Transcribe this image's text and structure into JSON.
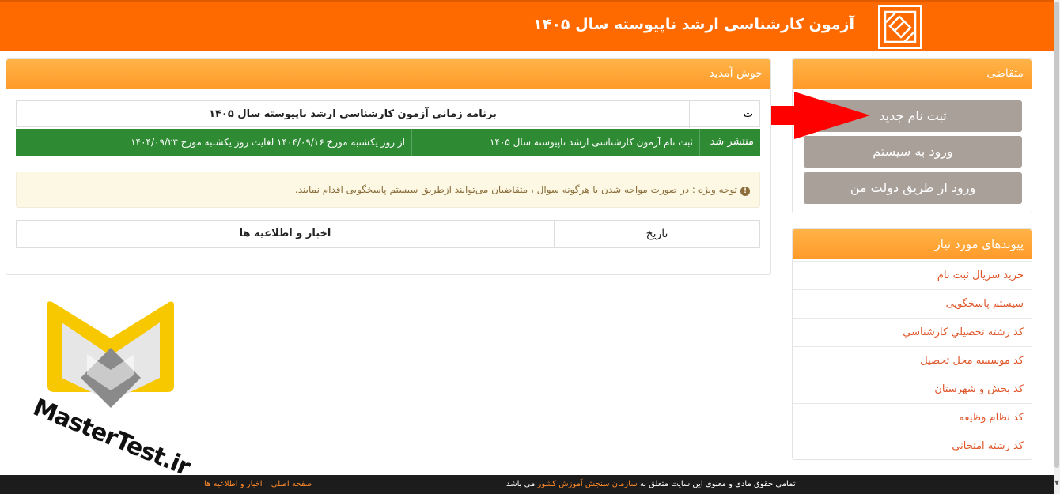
{
  "header": {
    "title": "آزمون کارشناسی ارشد ناپیوسته سال ۱۴۰۵"
  },
  "applicant_panel": {
    "title": "متقاضی",
    "buttons": {
      "register": "ثبت نام جدید",
      "login": "ورود به سیستم",
      "gov_login": "ورود از طریق دولت من"
    }
  },
  "links_panel": {
    "title": "پیوندهای مورد نیاز",
    "items": [
      "خرید سریال ثبت نام",
      "سیستم پاسخگویی",
      "کد رشته تحصيلي کارشناسي",
      "کد موسسه محل تحصيل",
      "کد بخش و شهرستان",
      "کد نظام وظيفه",
      "کد رشته امتحاني"
    ]
  },
  "welcome_panel": {
    "title": "خوش آمدید",
    "row1": {
      "label": "ت",
      "value": "برنامه زمانی آزمون کارشناسی ارشد ناپیوسته سال ۱۴۰۵"
    },
    "row2": {
      "status": "منتشر شد",
      "event": "ثبت نام آزمون کارشناسی ارشد ناپیوسته سال ۱۴۰۵",
      "date_range": "از روز یکشنبه مورخ ۱۴۰۴/۰۹/۱۶ لغایت روز یکشنبه مورخ ۱۴۰۴/۰۹/۲۳"
    },
    "notice": "توجه ویژه : در صورت مواجه شدن با هرگونه سوال ، متقاضیان می‌توانند ازطریق سیستم پاسخگویی اقدام نمایند.",
    "news_table": {
      "date_header": "تاریخ",
      "news_header": "اخبار و اطلاعیه ها"
    }
  },
  "watermark": {
    "text": "MasterTest.ir"
  },
  "footer": {
    "rights_prefix": "تمامی حقوق مادی و معنوی این سایت متعلق به",
    "org_link": "سازمان سنجش آموزش کشور",
    "rights_suffix": "می باشد",
    "nav_home": "صفحه اصلی",
    "nav_news": "اخبار و اطلاعیه ها"
  },
  "colors": {
    "header": "#ff6a00",
    "panel_head": "#ffa030",
    "button": "#aaa09a",
    "published_row": "#2e8b34",
    "link": "#e0562a",
    "notice_bg": "#fcf8e3",
    "arrow": "#ff0000"
  }
}
